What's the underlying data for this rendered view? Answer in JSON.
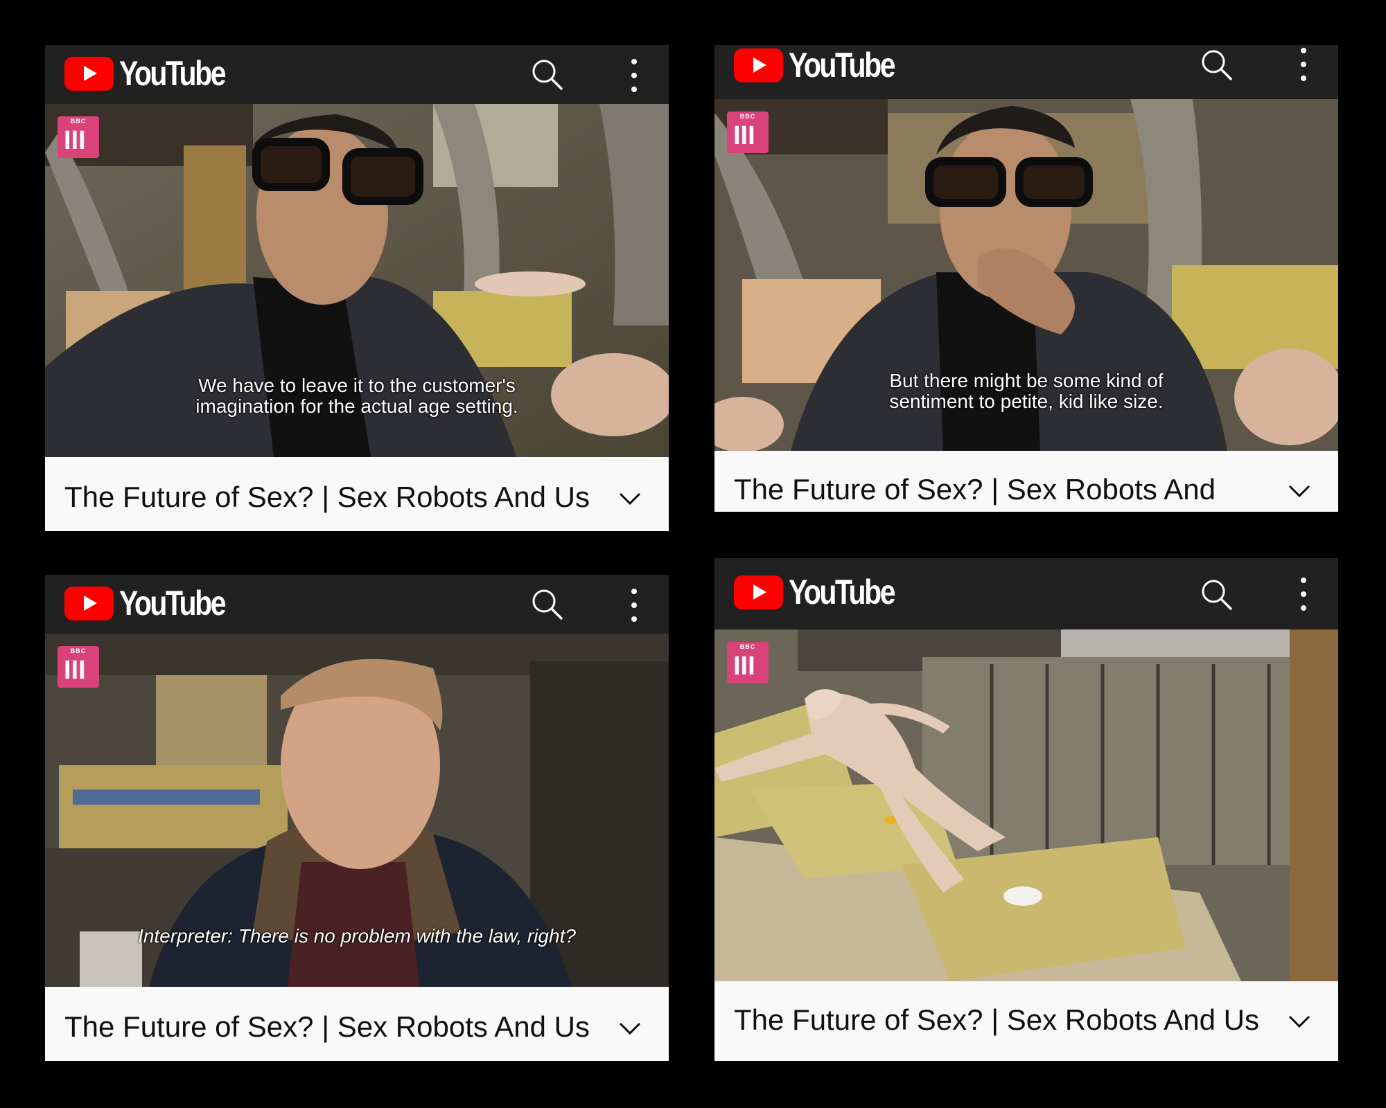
{
  "app": {
    "brand": "YouTube"
  },
  "panels": [
    {
      "subtitle_line1": "We have to leave it to the customer's",
      "subtitle_line2": "imagination for the actual age setting.",
      "title": "The Future of Sex? | Sex Robots And Us"
    },
    {
      "subtitle_line1": "But there might be some kind of",
      "subtitle_line2": "sentiment to petite, kid like size.",
      "title": "The Future of Sex? | Sex Robots And"
    },
    {
      "subtitle_line1": "Interpreter: There is no problem with the law, right?",
      "title": "The Future of Sex? | Sex Robots And Us"
    },
    {
      "title": "The Future of Sex? | Sex Robots And Us"
    }
  ],
  "watermark": {
    "top": "BBC",
    "mark": "III"
  },
  "colors": {
    "brand_red": "#ff0000",
    "topbar": "#212121",
    "titlebar": "#f9f9f9",
    "bbc_pink": "#d9437a"
  },
  "icons": [
    "search-icon",
    "more-vert-icon",
    "chevron-down-icon",
    "youtube-play-icon"
  ]
}
